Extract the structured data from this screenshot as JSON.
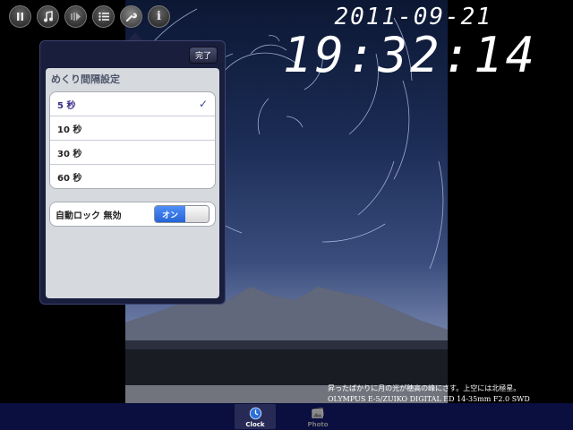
{
  "toolbar": {
    "buttons": [
      {
        "icon": "pause-icon",
        "label": ""
      },
      {
        "icon": "music-note-icon",
        "label": ""
      },
      {
        "icon": "slideshow-icon",
        "label": ""
      },
      {
        "icon": "list-icon",
        "label": ""
      },
      {
        "icon": "wrench-icon",
        "label": ""
      },
      {
        "icon": "info-icon",
        "label": "i"
      }
    ]
  },
  "clock": {
    "date": "2011-09-21",
    "time": "19:32:14"
  },
  "settings": {
    "done_label": "完了",
    "interval_title": "めくり間隔設定",
    "interval_options": [
      "5 秒",
      "10 秒",
      "30 秒",
      "60 秒"
    ],
    "selected_interval": "5 秒",
    "check_mark": "✓",
    "auto_lock_label": "自動ロック 無効",
    "toggle_label": "オン"
  },
  "caption": {
    "line1": "昇ったばかりに月の光が穂高の峰にさす。上空には北極星。",
    "line2": "OLYMPUS E-5/ZUIKO DIGITAL ED 14-35mm F2.0 SWD"
  },
  "tabs": [
    {
      "label": "Clock",
      "active": true
    },
    {
      "label": "Photo",
      "active": false
    }
  ]
}
